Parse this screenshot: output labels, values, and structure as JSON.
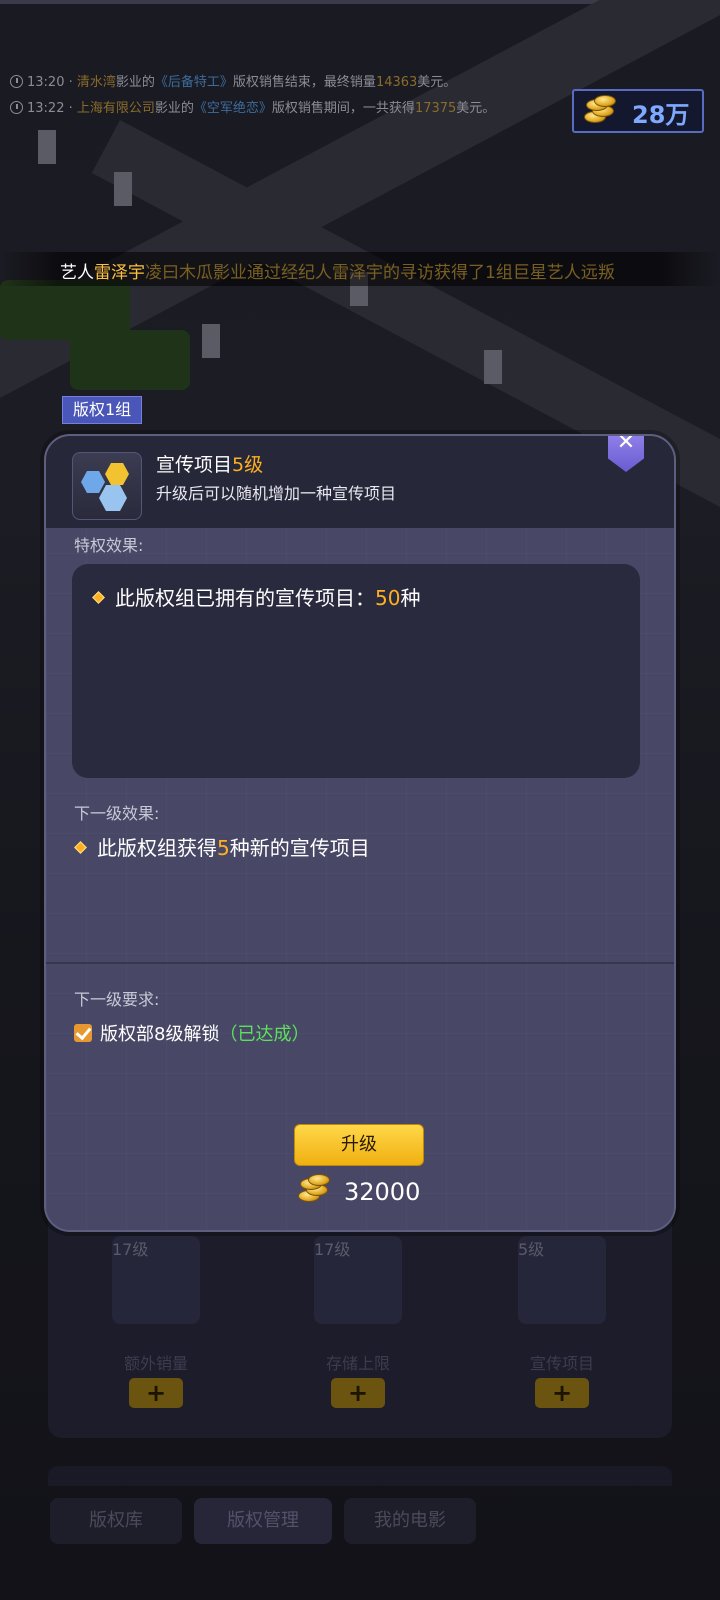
{
  "news": [
    {
      "time": "13:20 ·",
      "studio": "清水湾",
      "mid1": "影业的",
      "film": "《后备特工》",
      "mid2": "版权销售结束，最终销量",
      "num": "14363",
      "tail": "美元。"
    },
    {
      "time": "13:22 ·",
      "studio": "上海有限公司",
      "mid1": "影业的",
      "film": "《空军绝恋》",
      "mid2": "版权销售期间，一共获得",
      "num": "17375",
      "tail": "美元。"
    }
  ],
  "currency": {
    "value": "28万",
    "icon": "gold-coins-icon"
  },
  "artist_banner": {
    "prefix": "艺人",
    "name": "雷泽宇",
    "rest": "凌曰木瓜影业通过经纪人雷泽宇的寻访获得了1组巨星艺人远叛"
  },
  "group_tag": "版权1组",
  "modal": {
    "title": "宣传项目",
    "title_level": "5级",
    "description": "升级后可以随机增加一种宣传项目",
    "close_icon": "close-icon",
    "privilege_label": "特权效果:",
    "privilege_text": "此版权组已拥有的宣传项目：",
    "privilege_value": "50",
    "privilege_unit": "种",
    "next_effect_label": "下一级效果:",
    "next_effect_text": "此版权组获得",
    "next_effect_value": "5",
    "next_effect_unit": "种新的宣传项目",
    "requirement_label": "下一级要求:",
    "requirement_text": "版权部8级解锁",
    "requirement_status": "（已达成）",
    "upgrade_label": "升级",
    "cost": "32000"
  },
  "slots": [
    {
      "level": "17级",
      "label": "额外销量",
      "plus": "+",
      "icon": "box-icon"
    },
    {
      "level": "17级",
      "label": "存储上限",
      "plus": "+",
      "icon": "hand-truck-icon"
    },
    {
      "level": "5级",
      "label": "宣传项目",
      "plus": "+",
      "icon": "promo-icon"
    }
  ],
  "tabs": [
    {
      "label": "版权库"
    },
    {
      "label": "版权管理",
      "active": true
    },
    {
      "label": "我的电影"
    }
  ],
  "colors": {
    "accent_gold": "#ffb020",
    "achieved_green": "#5ee05e",
    "coin_text": "#7fa8ff"
  }
}
